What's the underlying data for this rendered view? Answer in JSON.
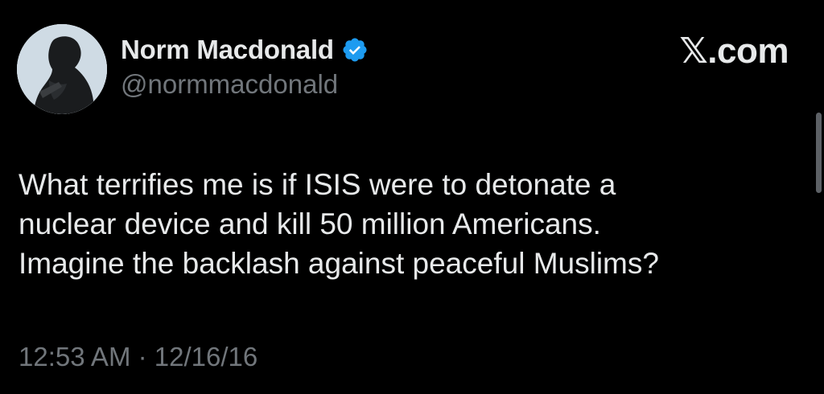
{
  "author": {
    "display_name": "Norm Macdonald",
    "handle": "@normmacdonald",
    "verified_icon": "verified-badge-icon"
  },
  "brand": {
    "label": "𝕏.com"
  },
  "tweet": {
    "text": "What terrifies me is if ISIS were to detonate a\nnuclear device and kill 50 million Americans.\nImagine the backlash against peaceful Muslims?",
    "timestamp": "12:53 AM · 12/16/16"
  },
  "colors": {
    "background": "#000000",
    "text": "#e7e9ea",
    "muted": "#71767b",
    "verified": "#1d9bf0"
  }
}
